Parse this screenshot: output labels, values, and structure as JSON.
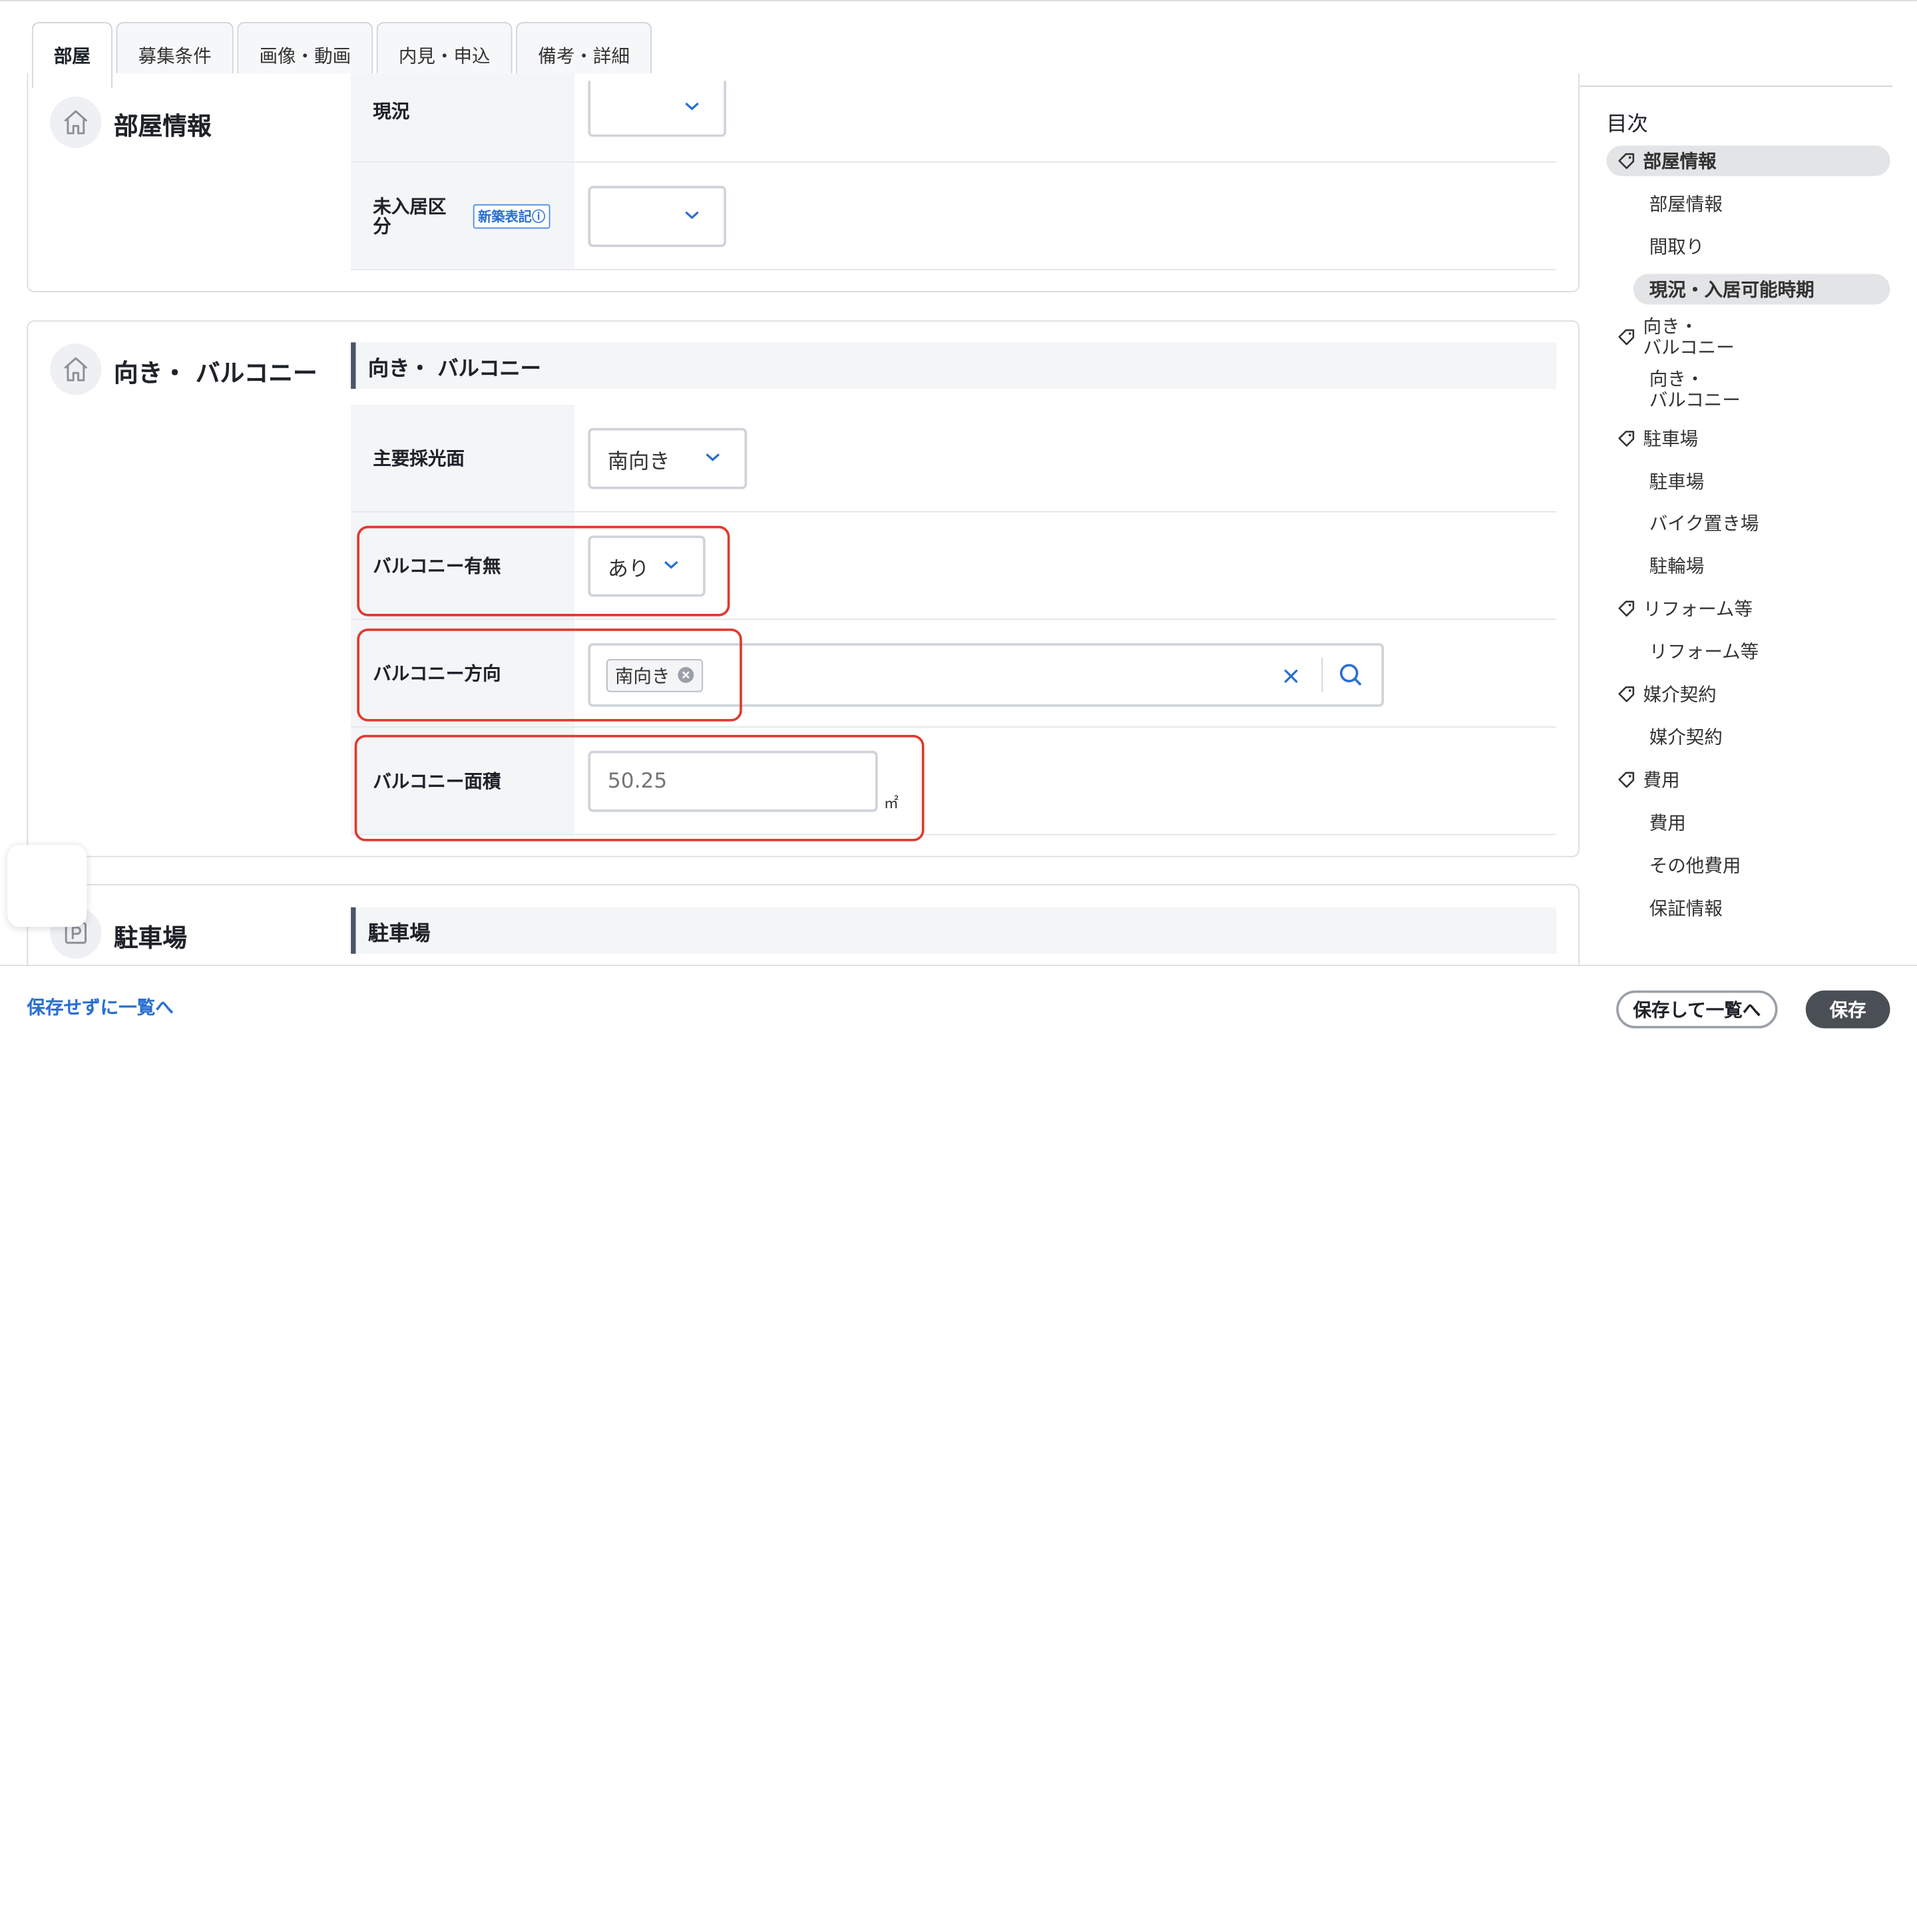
{
  "tabs": [
    {
      "label": "部屋",
      "active": true
    },
    {
      "label": "募集条件",
      "active": false
    },
    {
      "label": "画像・動画",
      "active": false
    },
    {
      "label": "内見・申込",
      "active": false
    },
    {
      "label": "備考・詳細",
      "active": false
    }
  ],
  "room_info": {
    "title": "部屋情報",
    "status_label": "現況",
    "status_value": "",
    "vacancy_label": "未入居区分",
    "vacancy_badge": "新築表記",
    "vacancy_value": ""
  },
  "orientation": {
    "title": "向き・ バルコニー",
    "sub_title": "向き・ バルコニー",
    "main_light_label": "主要採光面",
    "main_light_value": "南向き",
    "balcony_label": "バルコニー有無",
    "balcony_value": "あり",
    "balcony_dir_label": "バルコニー方向",
    "balcony_dir_tag": "南向き",
    "balcony_area_label": "バルコニー面積",
    "balcony_area_placeholder": "50.25",
    "balcony_area_unit": "㎡"
  },
  "parking": {
    "title": "駐車場",
    "sub_title": "駐車場"
  },
  "toc": {
    "title": "目次",
    "items": [
      {
        "label": "部屋情報",
        "level": 1,
        "active": true
      },
      {
        "label": "部屋情報",
        "level": 2
      },
      {
        "label": "間取り",
        "level": 2
      },
      {
        "label": "現況・入居可能時期",
        "level": 2,
        "active": true
      },
      {
        "label": "向き・",
        "label2": "バルコニー",
        "level": 1
      },
      {
        "label": "向き・",
        "label2": "バルコニー",
        "level": 2
      },
      {
        "label": "駐車場",
        "level": 1
      },
      {
        "label": "駐車場",
        "level": 2
      },
      {
        "label": "バイク置き場",
        "level": 2
      },
      {
        "label": "駐輪場",
        "level": 2
      },
      {
        "label": "リフォーム等",
        "level": 1
      },
      {
        "label": "リフォーム等",
        "level": 2
      },
      {
        "label": "媒介契約",
        "level": 1
      },
      {
        "label": "媒介契約",
        "level": 2
      },
      {
        "label": "費用",
        "level": 1
      },
      {
        "label": "費用",
        "level": 2
      },
      {
        "label": "その他費用",
        "level": 2
      },
      {
        "label": "保証情報",
        "level": 2
      }
    ]
  },
  "footer": {
    "back_link": "保存せずに一覧へ",
    "save_and_list": "保存して一覧へ",
    "save": "保存"
  },
  "colors": {
    "accent_blue": "#2a6fd1",
    "highlight_red": "#e03a2e",
    "dark_button": "#4a4f55"
  }
}
